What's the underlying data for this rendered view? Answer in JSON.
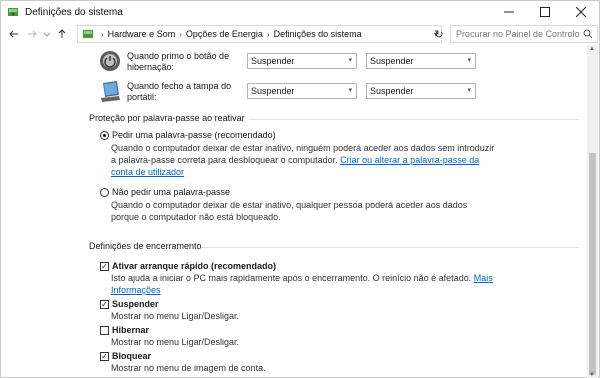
{
  "window": {
    "title": "Definições do sistema"
  },
  "nav": {
    "breadcrumbs": [
      "Hardware e Som",
      "Opções de Energia",
      "Definições do sistema"
    ],
    "search_placeholder": "Procurar no Painel de Controlo"
  },
  "power_rows": [
    {
      "label": "Quando primo o botão de hibernação:",
      "battery": "Suspender",
      "plugged": "Suspender"
    },
    {
      "label": "Quando fecho a tampa do portátil:",
      "battery": "Suspender",
      "plugged": "Suspender"
    }
  ],
  "password_section": {
    "title": "Proteção por palavra-passe ao reativar",
    "option1_label": "Pedir uma palavra-passe (recomendado)",
    "option1_desc": "Quando o computador deixar de estar inativo, ninguém poderá aceder aos dados sem introduzir a palavra-passe correta para desbloquear o computador.",
    "option1_link": "Criar ou alterar a palavra-passe da conta de utilizador",
    "option2_label": "Não pedir uma palavra-passe",
    "option2_desc": "Quando o computador deixar de estar inativo, qualquer pessoa poderá aceder aos dados porque o computador não está bloqueado."
  },
  "shutdown_section": {
    "title": "Definições de encerramento",
    "items": [
      {
        "label": "Ativar arranque rápido (recomendado)",
        "desc": "Isto ajuda a iniciar o PC mais rapidamente após o encerramento. O reinício não é afetado.",
        "link": "Mais Informações",
        "checked": true
      },
      {
        "label": "Suspender",
        "desc": "Mostrar no menu Ligar/Desligar.",
        "checked": true
      },
      {
        "label": "Hibernar",
        "desc": "Mostrar no menu Ligar/Desligar.",
        "checked": false
      },
      {
        "label": "Bloquear",
        "desc": "Mostrar no menu de imagem de conta.",
        "checked": true
      }
    ]
  }
}
